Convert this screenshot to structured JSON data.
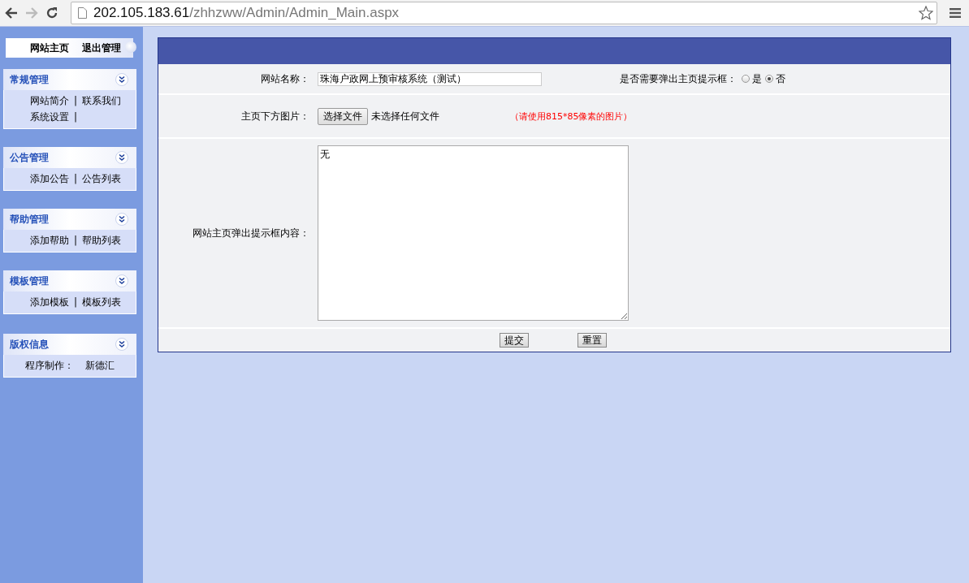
{
  "browser": {
    "url_host": "202.105.183.61",
    "url_path": "/zhhzww/Admin/Admin_Main.aspx"
  },
  "top_links": [
    "网站主页",
    "退出管理"
  ],
  "sidebar": [
    {
      "title": "常规管理",
      "rows": [
        [
          {
            "kind": "link",
            "text": "网站简介"
          },
          {
            "kind": "separator",
            "text": "|"
          },
          {
            "kind": "link",
            "text": "联系我们"
          }
        ],
        [
          {
            "kind": "link",
            "text": "系统设置"
          },
          {
            "kind": "separator",
            "text": "|"
          }
        ]
      ]
    },
    {
      "title": "公告管理",
      "rows": [
        [
          {
            "kind": "link",
            "text": "添加公告"
          },
          {
            "kind": "separator",
            "text": "|"
          },
          {
            "kind": "link",
            "text": "公告列表"
          }
        ]
      ]
    },
    {
      "title": "帮助管理",
      "rows": [
        [
          {
            "kind": "link",
            "text": "添加帮助"
          },
          {
            "kind": "separator",
            "text": "|"
          },
          {
            "kind": "link",
            "text": "帮助列表"
          }
        ]
      ]
    },
    {
      "title": "模板管理",
      "rows": [
        [
          {
            "kind": "link",
            "text": "添加模板"
          },
          {
            "kind": "separator",
            "text": "|"
          },
          {
            "kind": "link",
            "text": "模板列表"
          }
        ]
      ]
    },
    {
      "title": "版权信息",
      "rows": [
        [
          {
            "kind": "text",
            "text": "程序制作："
          },
          {
            "kind": "text",
            "text": "新德汇"
          }
        ]
      ]
    }
  ],
  "form": {
    "site_name": {
      "label": "网站名称：",
      "value": "珠海户政网上预审核系统（测试）"
    },
    "popup": {
      "label": "是否需要弹出主页提示框：",
      "options": [
        {
          "label": "是",
          "selected": false
        },
        {
          "label": "否",
          "selected": true
        }
      ]
    },
    "image": {
      "label": "主页下方图片：",
      "button": "选择文件",
      "status": "未选择任何文件",
      "note": "（请使用815*85像素的图片）"
    },
    "content": {
      "label": "网站主页弹出提示框内容：",
      "value": "无"
    },
    "buttons": [
      "提交",
      "重置"
    ]
  }
}
